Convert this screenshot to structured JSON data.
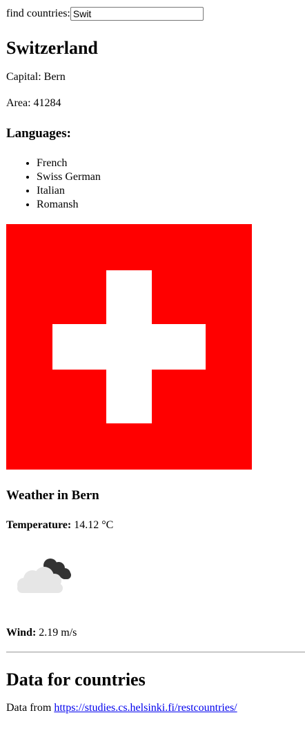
{
  "search": {
    "label": "find countries:",
    "value": "Swit"
  },
  "country": {
    "name": "Switzerland",
    "capital_label": "Capital:",
    "capital": "Bern",
    "area_label": "Area:",
    "area": "41284",
    "languages_heading": "Languages:",
    "languages": [
      "French",
      "Swiss German",
      "Italian",
      "Romansh"
    ],
    "flag": {
      "icon": "swiss-flag",
      "background_color": "#ff0000",
      "cross_color": "#ffffff"
    }
  },
  "weather": {
    "heading": "Weather in Bern",
    "temperature_label": "Temperature:",
    "temperature": "14.12 °C",
    "icon": "cloudy-weather-icon",
    "wind_label": "Wind:",
    "wind": "2.19 m/s"
  },
  "footer": {
    "title": "Data for countries",
    "credit_prefix": "Data from",
    "credit_link": "https://studies.cs.helsinki.fi/restcountries/"
  }
}
